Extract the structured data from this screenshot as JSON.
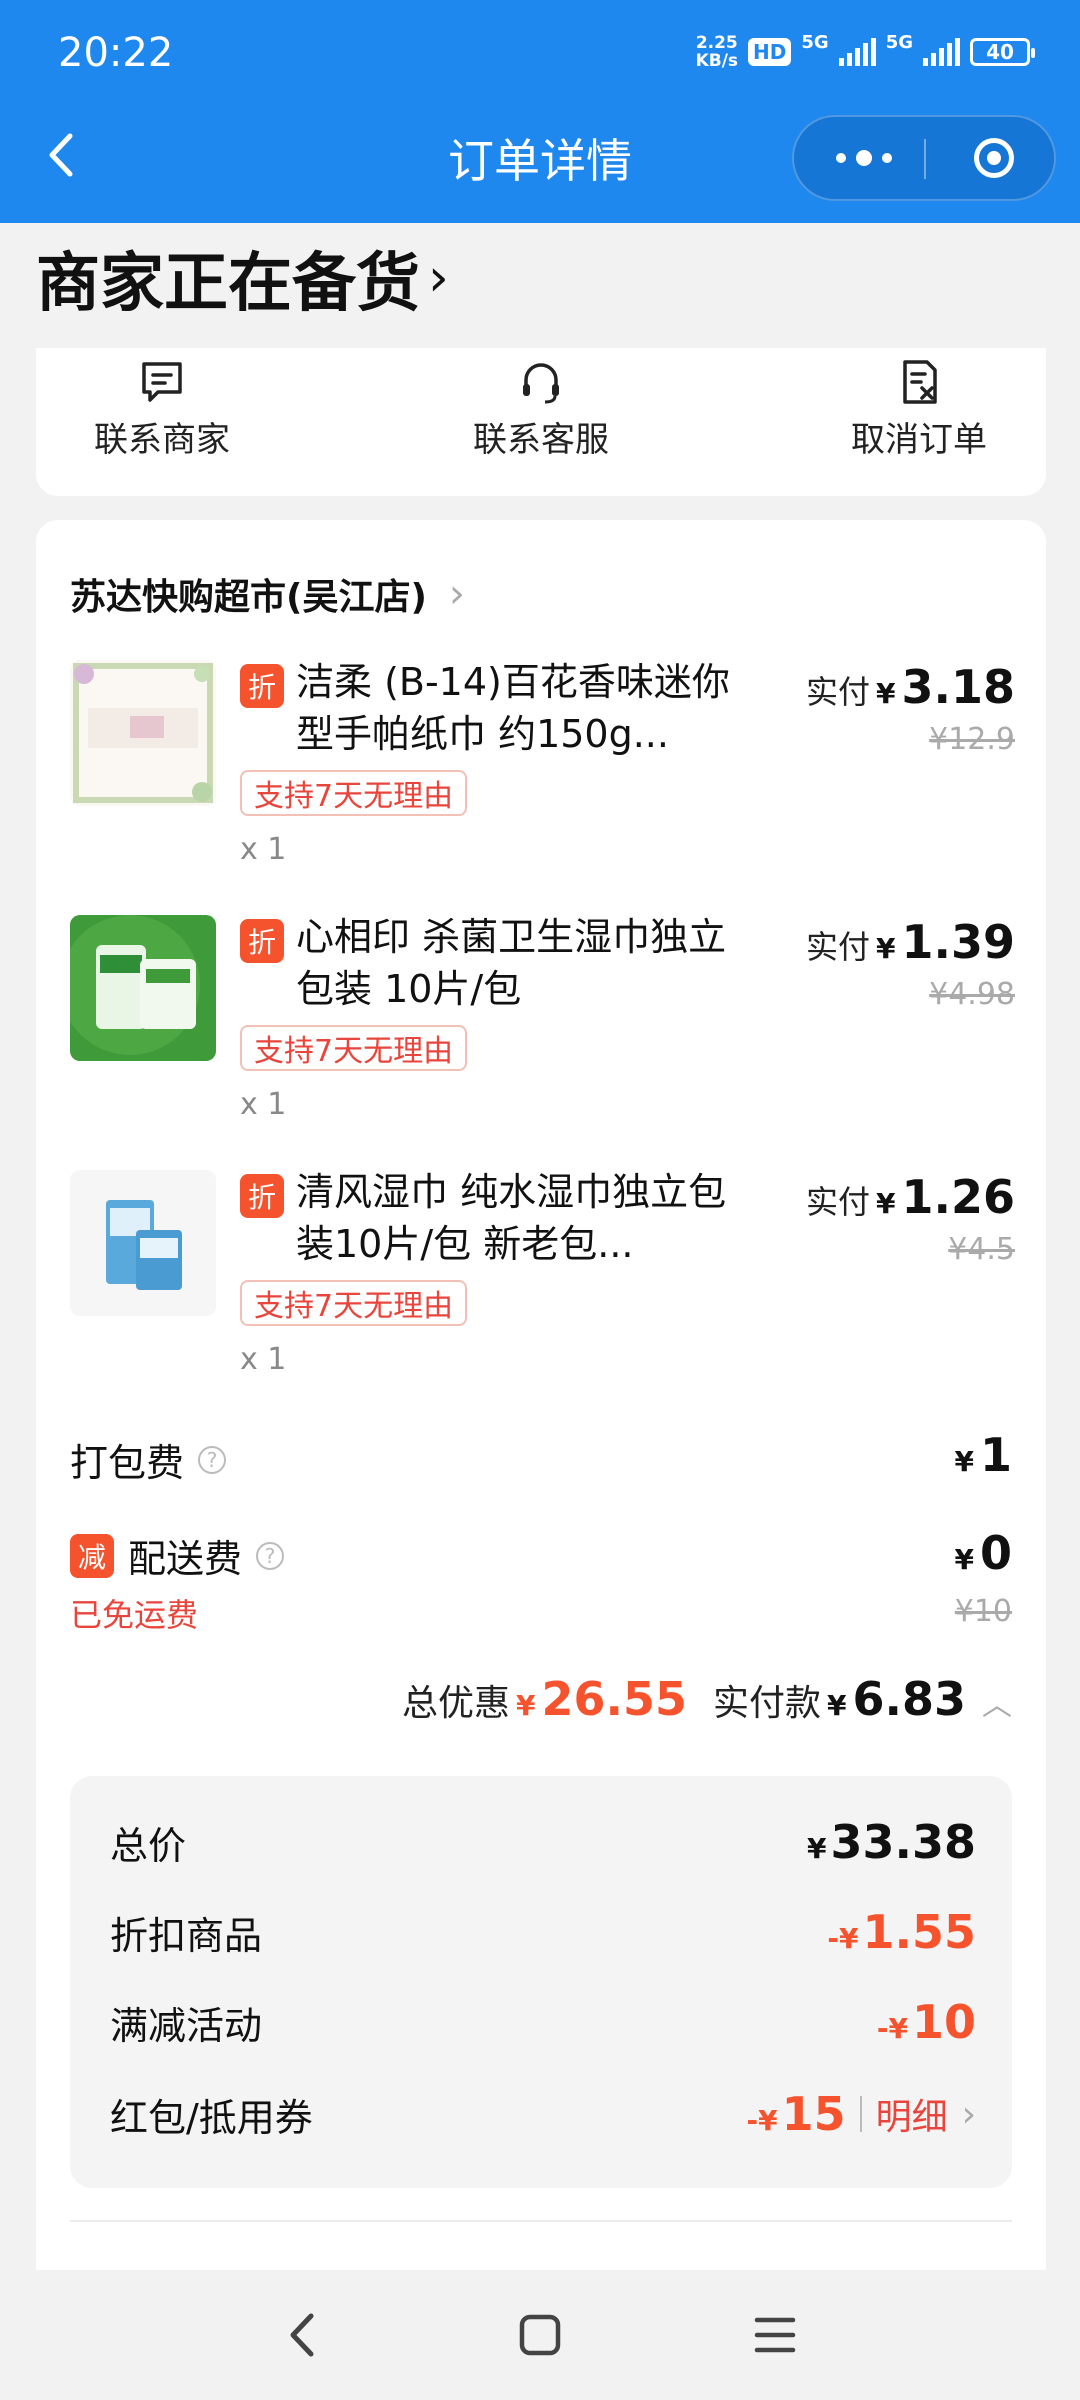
{
  "status_bar": {
    "time": "20:22",
    "speed_value": "2.25",
    "speed_unit": "KB/s",
    "hd": "HD",
    "net1": "5G",
    "net2": "5G",
    "battery": "40"
  },
  "nav": {
    "title": "订单详情",
    "icons": [
      "back-icon",
      "more-icon",
      "target-icon"
    ]
  },
  "order_status": "商家正在备货",
  "actions": [
    {
      "label": "联系商家",
      "icon": "chat-icon"
    },
    {
      "label": "联系客服",
      "icon": "headset-icon"
    },
    {
      "label": "取消订单",
      "icon": "cancel-doc-icon"
    }
  ],
  "shop": {
    "name": "苏达快购超市(吴江店)"
  },
  "items": [
    {
      "badge": "折",
      "name": "洁柔 (B-14)百花香味迷你型手帕纸巾 约150g...",
      "tag": "支持7天无理由",
      "qty": "x 1",
      "price_label": "实付",
      "currency": "¥",
      "price": "3.18",
      "original": "¥12.9"
    },
    {
      "badge": "折",
      "name": "心相印 杀菌卫生湿巾独立包装 10片/包",
      "tag": "支持7天无理由",
      "qty": "x 1",
      "price_label": "实付",
      "currency": "¥",
      "price": "1.39",
      "original": "¥4.98"
    },
    {
      "badge": "折",
      "name": "清风湿巾 纯水湿巾独立包装10片/包 新老包...",
      "tag": "支持7天无理由",
      "qty": "x 1",
      "price_label": "实付",
      "currency": "¥",
      "price": "1.26",
      "original": "¥4.5"
    }
  ],
  "fees": {
    "packing": {
      "label": "打包费",
      "help": "?",
      "currency": "¥",
      "value": "1"
    },
    "delivery": {
      "badge": "减",
      "label": "配送费",
      "help": "?",
      "currency": "¥",
      "value": "0",
      "note": "已免运费",
      "original": "¥10"
    }
  },
  "summary": {
    "discount_label": "总优惠",
    "currency": "¥",
    "discount": "26.55",
    "paid_label": "实付款",
    "paid": "6.83"
  },
  "breakdown": [
    {
      "label": "总价",
      "prefix": "¥",
      "value": "33.38"
    },
    {
      "label": "折扣商品",
      "prefix": "-¥",
      "value": "1.55"
    },
    {
      "label": "满减活动",
      "prefix": "-¥",
      "value": "10"
    },
    {
      "label": "红包/抵用券",
      "prefix": "-¥",
      "value": "15",
      "detail": "明细"
    }
  ],
  "colors": {
    "brand_blue": "#1f88ef",
    "accent_red": "#f5532d"
  }
}
